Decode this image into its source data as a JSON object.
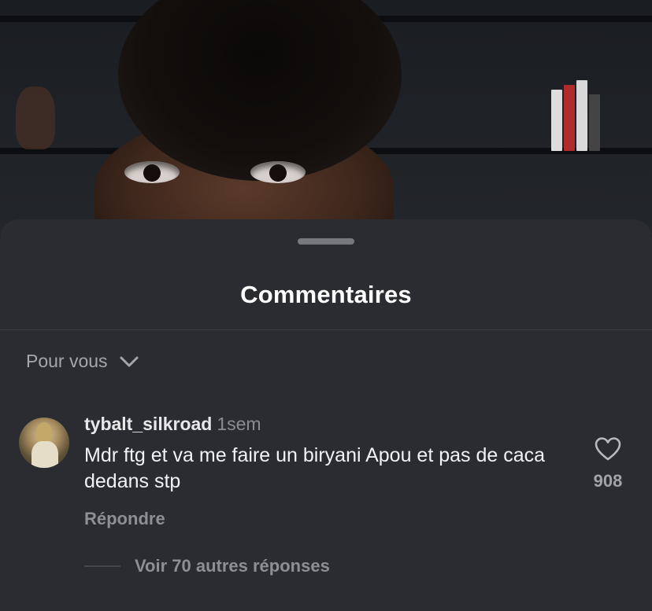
{
  "sheet": {
    "title": "Commentaires",
    "sort_label": "Pour vous"
  },
  "comments": [
    {
      "username": "tybalt_silkroad",
      "timestamp": "1sem",
      "text": "Mdr ftg et va me faire un biryani Apou et pas de caca dedans stp",
      "reply_label": "Répondre",
      "like_count": "908",
      "view_replies_label": "Voir 70 autres réponses"
    }
  ],
  "icons": {
    "sort": "chevron-down-icon",
    "like": "heart-outline-icon"
  },
  "colors": {
    "sheet_background": "#2a2c31",
    "text_primary": "#ffffff",
    "text_secondary": "#8e8f94"
  }
}
